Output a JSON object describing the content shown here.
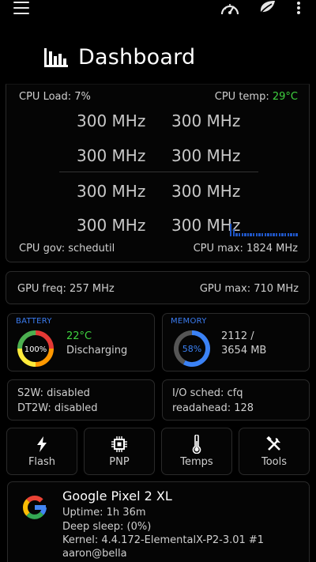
{
  "header": {
    "title": "Dashboard",
    "icons": [
      "menu-icon",
      "speedometer-icon",
      "leaf-icon",
      "more-vert-icon"
    ]
  },
  "cpu": {
    "load_label": "CPU Load: 7%",
    "temp_label": "CPU temp:",
    "temp_value": "29°C",
    "freqs": [
      "300 MHz",
      "300 MHz",
      "300 MHz",
      "300 MHz",
      "300 MHz",
      "300 MHz",
      "300 MHz",
      "300 MHz"
    ],
    "gov_label": "CPU gov: schedutil",
    "max_label": "CPU max: 1824 MHz",
    "load_history_percent": [
      38,
      22,
      10,
      10,
      9,
      10,
      10,
      10,
      10,
      10,
      10,
      9,
      10,
      10,
      10,
      10,
      10,
      10,
      10,
      10,
      10,
      10,
      10,
      10
    ],
    "accent": "#1f56c8"
  },
  "gpu": {
    "freq_label": "GPU freq: 257 MHz",
    "max_label": "GPU max: 710 MHz"
  },
  "battery": {
    "label": "BATTERY",
    "percent_text": "100%",
    "percent": 100,
    "temp": "22°C",
    "status": "Discharging",
    "colors": [
      "#e53935",
      "#ff9800",
      "#ffeb3b",
      "#4caf50"
    ]
  },
  "memory": {
    "label": "MEMORY",
    "percent_text": "58%",
    "percent": 58,
    "used": "2112 /",
    "total": "3654 MB",
    "color": "#3b82f6",
    "track_color": "#555555"
  },
  "wake": {
    "s2w": "S2W: disabled",
    "dt2w": "DT2W: disabled"
  },
  "io": {
    "sched": "I/O sched: cfq",
    "readahead": "readahead: 128"
  },
  "tools": [
    {
      "label": "Flash",
      "icon": "flash-icon"
    },
    {
      "label": "PNP",
      "icon": "chip-icon"
    },
    {
      "label": "Temps",
      "icon": "thermometer-icon"
    },
    {
      "label": "Tools",
      "icon": "tools-icon"
    }
  ],
  "device": {
    "name": "Google Pixel 2 XL",
    "uptime": "Uptime: 1h 36m",
    "deep_sleep": "Deep sleep:  (0%)",
    "kernel": "Kernel: 4.4.172-ElementalX-P2-3.01 #1",
    "user": "aaron@bella",
    "logo_icon": "google-g-icon"
  }
}
